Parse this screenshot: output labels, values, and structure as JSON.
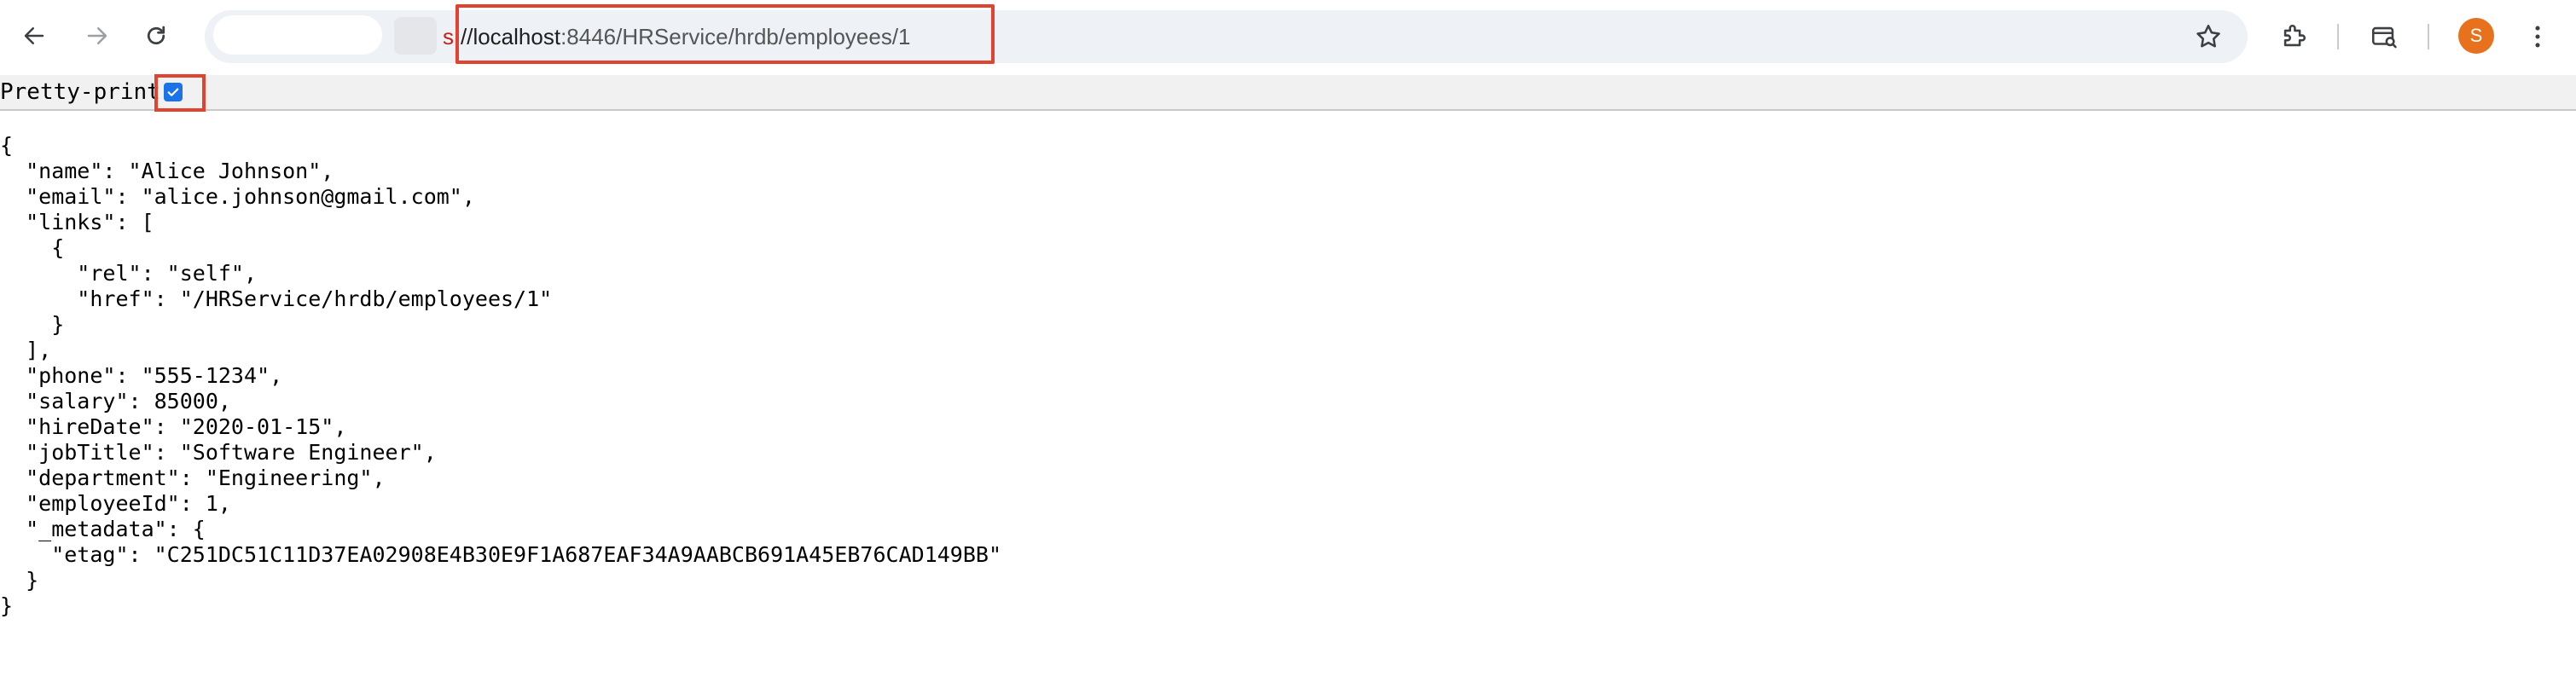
{
  "browser": {
    "url_scheme_fragment": "s",
    "url_host": "//localhost",
    "url_port_path": ":8446/HRService/hrdb/employees/1",
    "profile_initial": "S",
    "icons": {
      "back": "back-arrow-icon",
      "forward": "forward-arrow-icon",
      "reload": "reload-icon",
      "bookmark": "star-icon",
      "extensions": "puzzle-icon",
      "tab_search": "tab-search-icon",
      "menu": "kebab-menu-icon"
    },
    "colors": {
      "accent": "#1a73e8",
      "avatar": "#e8711e",
      "highlight": "#e0432f"
    }
  },
  "viewer": {
    "pretty_print_label": "Pretty-print",
    "pretty_print_checked": true
  },
  "json_text": "{\n  \"name\": \"Alice Johnson\",\n  \"email\": \"alice.johnson@gmail.com\",\n  \"links\": [\n    {\n      \"rel\": \"self\",\n      \"href\": \"/HRService/hrdb/employees/1\"\n    }\n  ],\n  \"phone\": \"555-1234\",\n  \"salary\": 85000,\n  \"hireDate\": \"2020-01-15\",\n  \"jobTitle\": \"Software Engineer\",\n  \"department\": \"Engineering\",\n  \"employeeId\": 1,\n  \"_metadata\": {\n    \"etag\": \"C251DC51C11D37EA02908E4B30E9F1A687EAF34A9AABCB691A45EB76CAD149BB\"\n  }\n}"
}
